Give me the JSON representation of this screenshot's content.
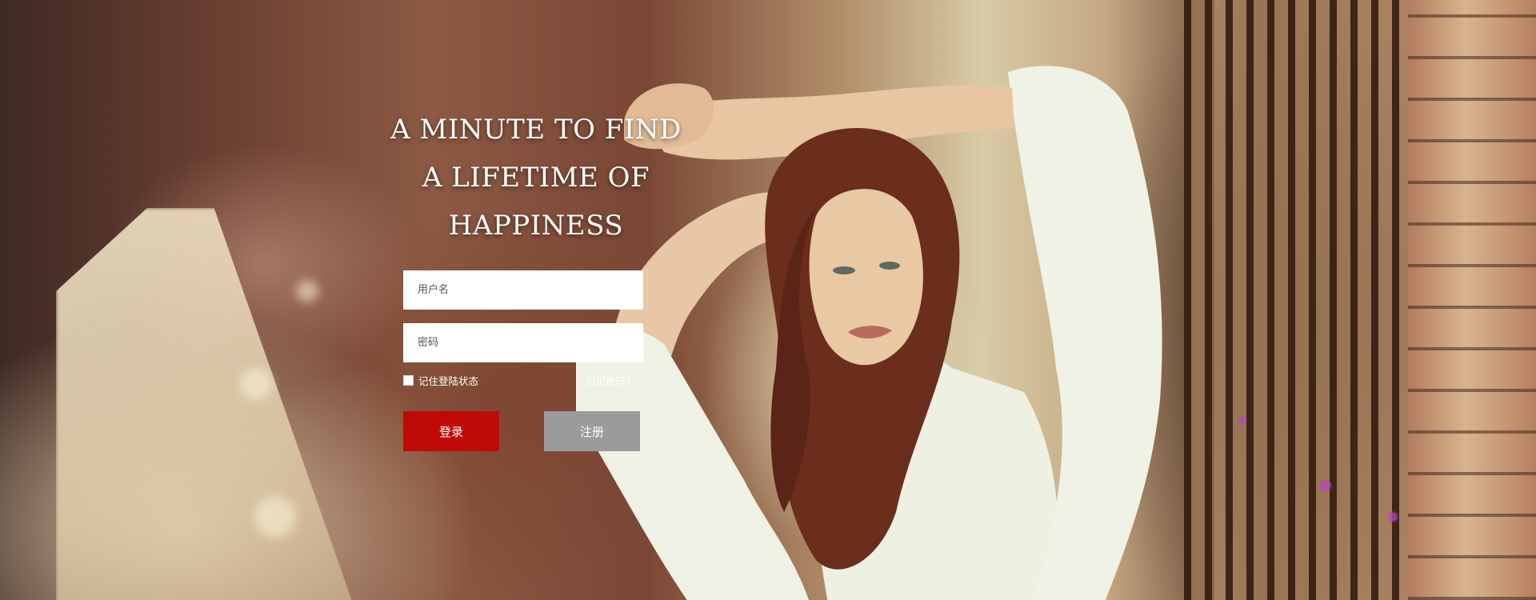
{
  "slogan": {
    "line1": "A MINUTE TO FIND",
    "line2": "A LIFETIME OF HAPPINESS"
  },
  "login_form": {
    "username_placeholder": "用户名",
    "password_placeholder": "密码",
    "remember_label": "记住登陆状态",
    "forgot_link": "忘记密码?",
    "login_button": "登录",
    "register_button": "注册"
  },
  "colors": {
    "login_button": "#c00a07",
    "register_button": "#9c9a9b",
    "slogan_text": "#ffffff"
  }
}
